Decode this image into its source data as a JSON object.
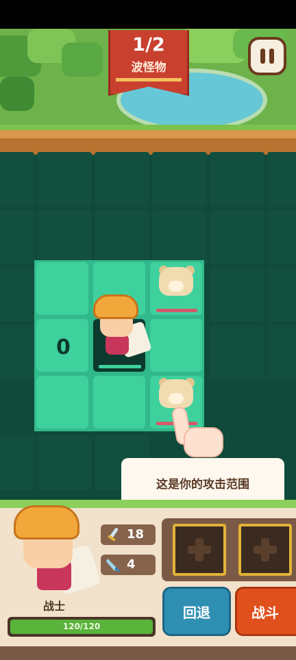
{
  "wave": {
    "count": "1/2",
    "label": "波怪物"
  },
  "board": {
    "range_value": "0"
  },
  "tooltip": {
    "text": "这是你的攻击范围"
  },
  "hero": {
    "class_name": "战士",
    "hp_text": "120/120",
    "hp_fraction": 1.0
  },
  "stats": {
    "attack": "18",
    "defense": "4"
  },
  "buttons": {
    "undo": "回退",
    "fight": "战斗"
  },
  "icons": {
    "pause": "pause-icon",
    "attack": "sword-icon",
    "defense": "dagger-icon",
    "add": "plus-icon"
  }
}
